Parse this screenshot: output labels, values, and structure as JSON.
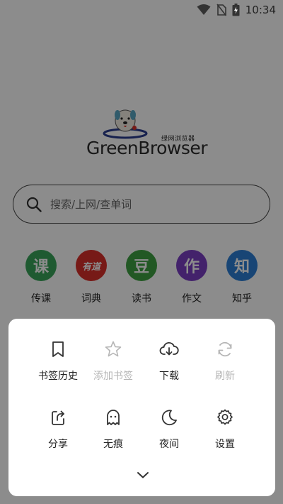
{
  "status_bar": {
    "time": "10:34"
  },
  "logo": {
    "brand": "GreenBrowser",
    "subtitle": "绿网浏览器"
  },
  "search": {
    "placeholder": "搜索/上网/查单词"
  },
  "quick_links": [
    {
      "label": "传课",
      "icon_text": "课",
      "color": "#3aa55a",
      "icon": "chuanke-icon"
    },
    {
      "label": "词典",
      "icon_text": "有道",
      "color": "#d9312b",
      "icon": "youdao-icon"
    },
    {
      "label": "读书",
      "icon_text": "豆",
      "color": "#3fa142",
      "icon": "douban-icon"
    },
    {
      "label": "作文",
      "icon_text": "作",
      "color": "#7b3fc4",
      "icon": "zuowen-icon"
    },
    {
      "label": "知乎",
      "icon_text": "知",
      "color": "#2d7fd6",
      "icon": "zhihu-icon"
    }
  ],
  "menu": {
    "items": [
      {
        "label": "书签历史",
        "icon": "bookmark-icon",
        "enabled": true
      },
      {
        "label": "添加书签",
        "icon": "star-icon",
        "enabled": false
      },
      {
        "label": "下载",
        "icon": "cloud-download-icon",
        "enabled": true
      },
      {
        "label": "刷新",
        "icon": "refresh-icon",
        "enabled": false
      },
      {
        "label": "分享",
        "icon": "share-icon",
        "enabled": true
      },
      {
        "label": "无痕",
        "icon": "ghost-icon",
        "enabled": true
      },
      {
        "label": "夜间",
        "icon": "moon-icon",
        "enabled": true
      },
      {
        "label": "设置",
        "icon": "gear-icon",
        "enabled": true
      }
    ]
  }
}
